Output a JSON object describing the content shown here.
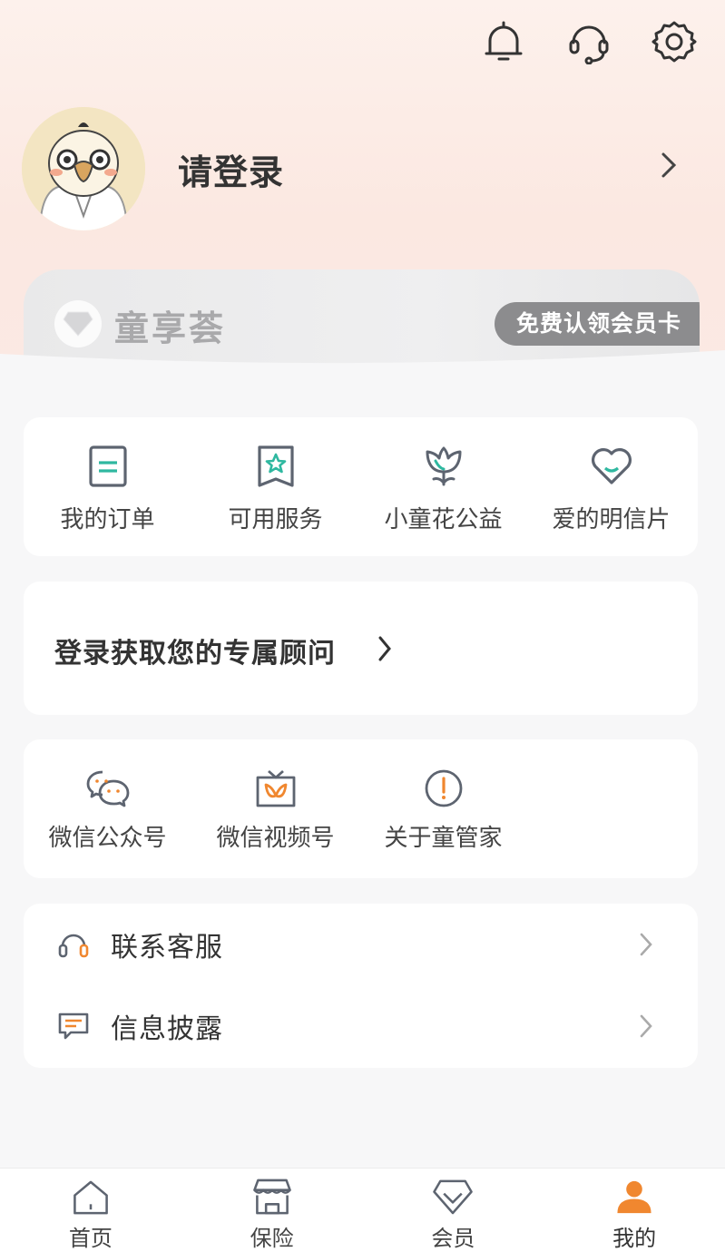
{
  "colors": {
    "accent": "#f0872f",
    "teal": "#2fb8a0",
    "icon_gray": "#888a8f"
  },
  "header": {
    "icons": [
      "bell-icon",
      "headset-icon",
      "gear-icon"
    ]
  },
  "profile": {
    "login_label": "请登录"
  },
  "member_card": {
    "name": "童享荟",
    "claim_label": "免费认领会员卡"
  },
  "quick_menu": [
    {
      "label": "我的订单",
      "icon": "order-icon"
    },
    {
      "label": "可用服务",
      "icon": "star-bookmark-icon"
    },
    {
      "label": "小童花公益",
      "icon": "flower-icon"
    },
    {
      "label": "爱的明信片",
      "icon": "heart-icon"
    }
  ],
  "advisor": {
    "label": "登录获取您的专属顾问"
  },
  "social_menu": [
    {
      "label": "微信公众号",
      "icon": "wechat-icon"
    },
    {
      "label": "微信视频号",
      "icon": "video-channel-icon"
    },
    {
      "label": "关于童管家",
      "icon": "info-icon"
    }
  ],
  "list": [
    {
      "label": "联系客服",
      "icon": "headset-icon"
    },
    {
      "label": "信息披露",
      "icon": "message-icon"
    }
  ],
  "tabbar": [
    {
      "label": "首页",
      "icon": "home-icon"
    },
    {
      "label": "保险",
      "icon": "store-icon"
    },
    {
      "label": "会员",
      "icon": "diamond-icon"
    },
    {
      "label": "我的",
      "icon": "user-icon",
      "active": true
    }
  ]
}
